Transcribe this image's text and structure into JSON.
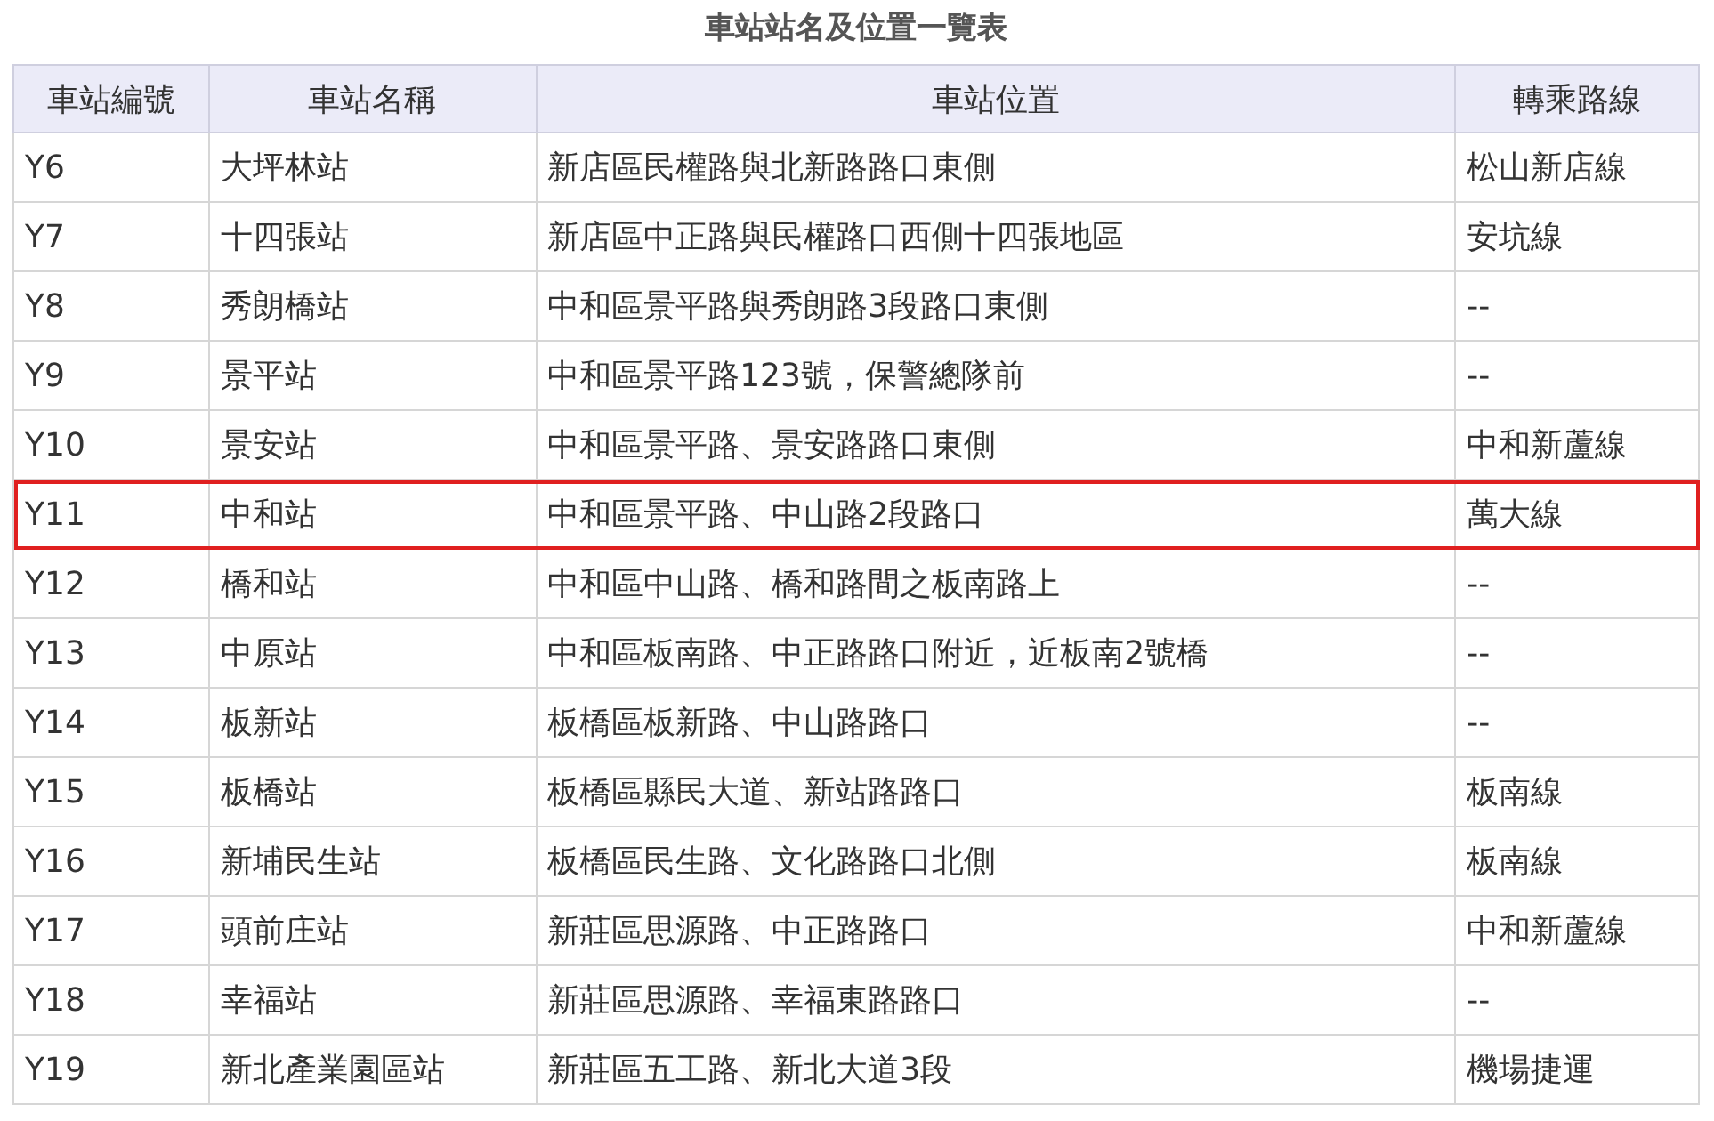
{
  "title": "車站站名及位置一覽表",
  "table": {
    "columns": [
      "車站編號",
      "車站名稱",
      "車站位置",
      "轉乘路線"
    ],
    "rows": [
      {
        "cells": [
          "Y6",
          "大坪林站",
          "新店區民權路與北新路路口東側",
          "松山新店線"
        ],
        "selected": false
      },
      {
        "cells": [
          "Y7",
          "十四張站",
          "新店區中正路與民權路口西側十四張地區",
          "安坑線"
        ],
        "selected": false
      },
      {
        "cells": [
          "Y8",
          "秀朗橋站",
          "中和區景平路與秀朗路3段路口東側",
          "--"
        ],
        "selected": false
      },
      {
        "cells": [
          "Y9",
          "景平站",
          "中和區景平路123號，保警總隊前",
          "--"
        ],
        "selected": false
      },
      {
        "cells": [
          "Y10",
          "景安站",
          "中和區景平路、景安路路口東側",
          "中和新蘆線"
        ],
        "selected": false
      },
      {
        "cells": [
          "Y11",
          "中和站",
          "中和區景平路、中山路2段路口",
          "萬大線"
        ],
        "selected": true
      },
      {
        "cells": [
          "Y12",
          "橋和站",
          "中和區中山路、橋和路間之板南路上",
          "--"
        ],
        "selected": false
      },
      {
        "cells": [
          "Y13",
          "中原站",
          "中和區板南路、中正路路口附近，近板南2號橋",
          "--"
        ],
        "selected": false
      },
      {
        "cells": [
          "Y14",
          "板新站",
          "板橋區板新路、中山路路口",
          "--"
        ],
        "selected": false
      },
      {
        "cells": [
          "Y15",
          "板橋站",
          "板橋區縣民大道、新站路路口",
          "板南線"
        ],
        "selected": false
      },
      {
        "cells": [
          "Y16",
          "新埔民生站",
          "板橋區民生路、文化路路口北側",
          "板南線"
        ],
        "selected": false
      },
      {
        "cells": [
          "Y17",
          "頭前庄站",
          "新莊區思源路、中正路路口",
          "中和新蘆線"
        ],
        "selected": false
      },
      {
        "cells": [
          "Y18",
          "幸福站",
          "新莊區思源路、幸福東路路口",
          "--"
        ],
        "selected": false
      },
      {
        "cells": [
          "Y19",
          "新北產業園區站",
          "新莊區五工路、新北大道3段",
          "機場捷運"
        ],
        "selected": false
      }
    ]
  }
}
